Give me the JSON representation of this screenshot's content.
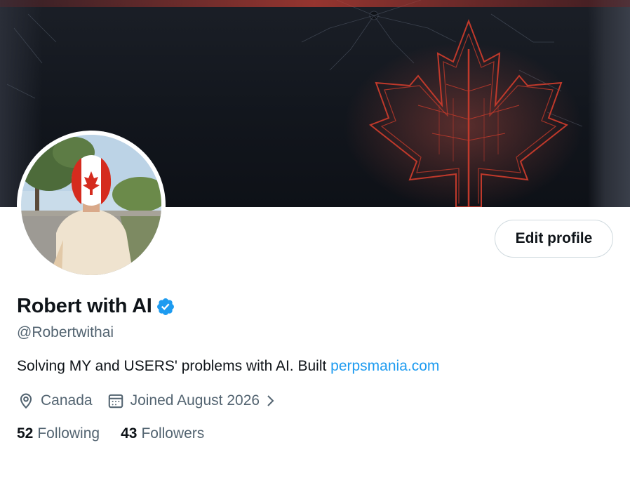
{
  "profile": {
    "display_name": "Robert with AI",
    "handle": "@Robertwithai",
    "bio_text": "Solving MY and USERS' problems with AI. Built ",
    "bio_link": "perpsmania.com",
    "location": "Canada",
    "joined": "Joined August 2026",
    "following_count": "52",
    "following_label": "Following",
    "followers_count": "43",
    "followers_label": "Followers"
  },
  "actions": {
    "edit_profile_label": "Edit profile"
  },
  "icons": {
    "verified": "verified-badge-icon",
    "location": "location-pin-icon",
    "calendar": "calendar-icon",
    "chevron": "chevron-right-icon"
  },
  "colors": {
    "accent": "#1d9bf0",
    "text_primary": "#0f1419",
    "text_secondary": "#536471",
    "border": "#cfd9de",
    "banner_leaf": "#c0392b"
  }
}
